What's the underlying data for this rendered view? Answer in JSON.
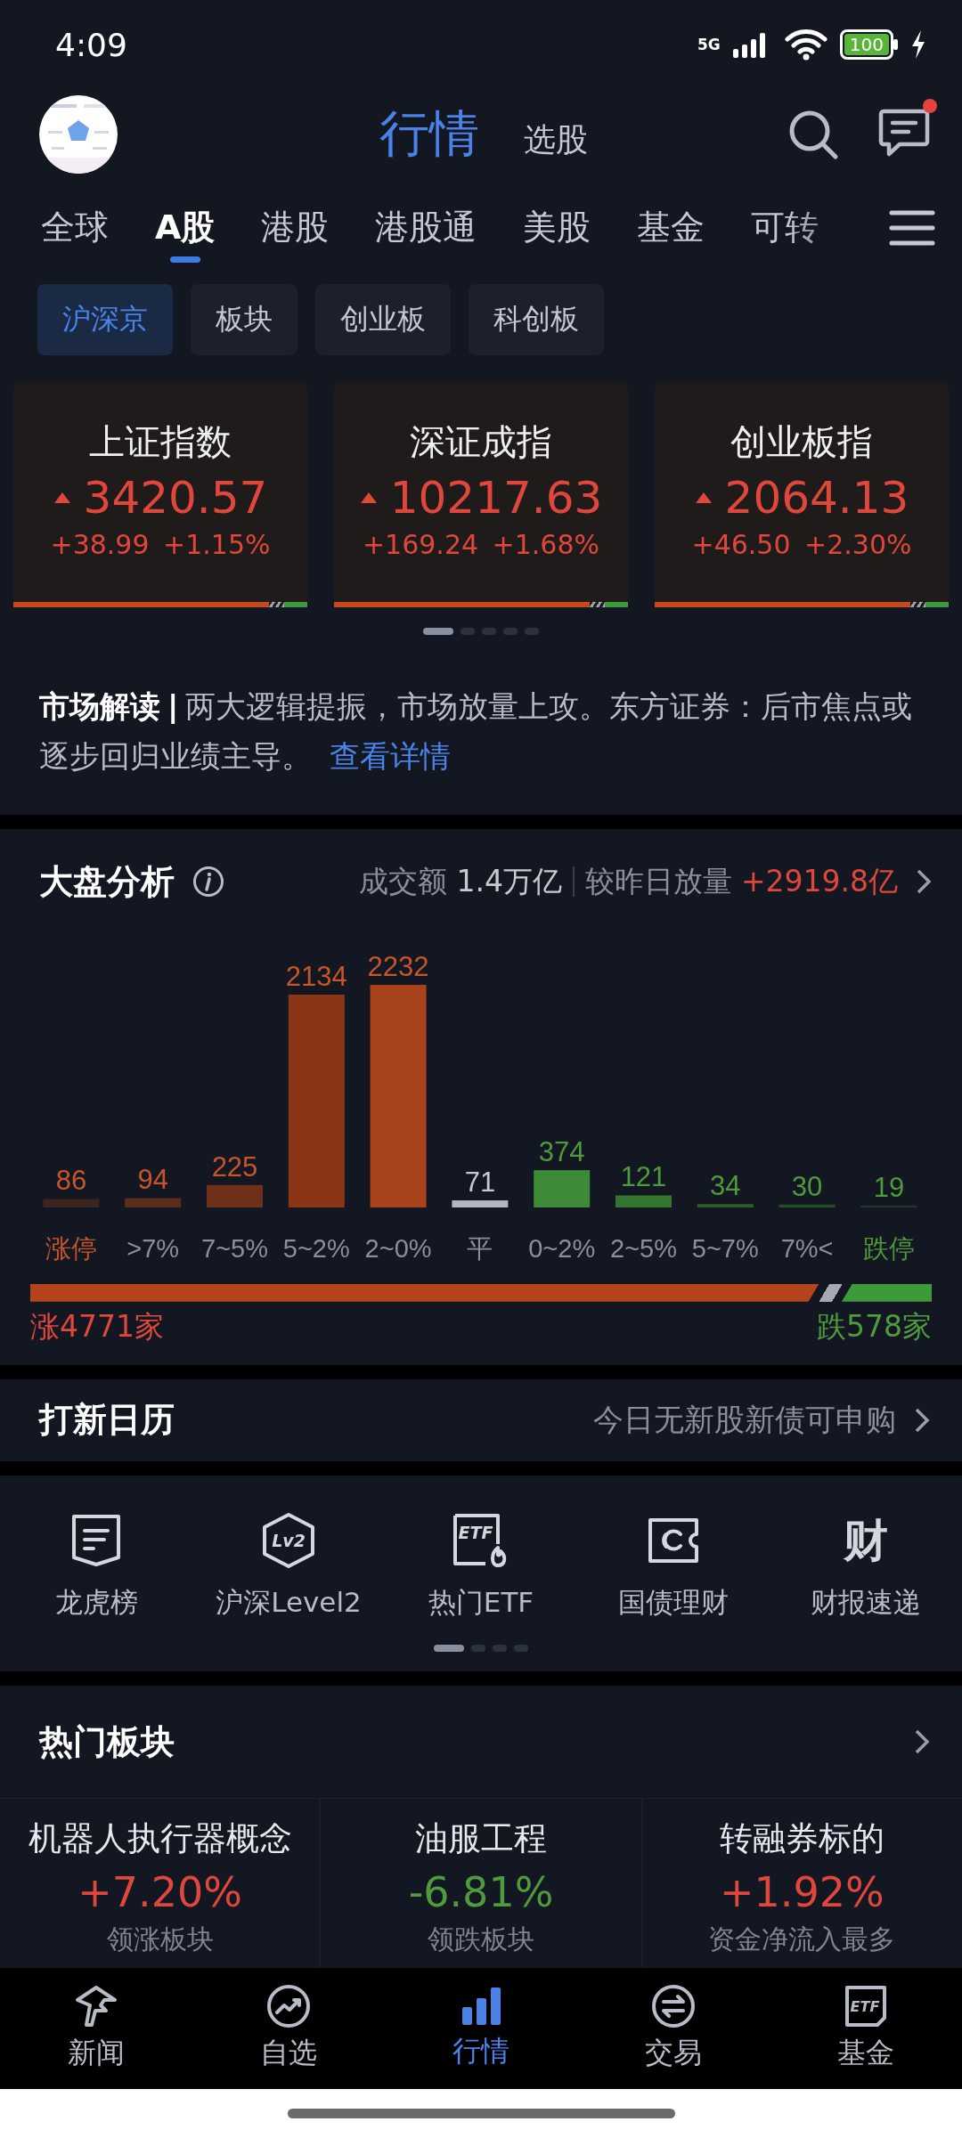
{
  "status_bar": {
    "time": "4:09",
    "network": "5G",
    "battery": "100"
  },
  "header": {
    "tabs": [
      {
        "label": "行情",
        "selected": true
      },
      {
        "label": "选股",
        "selected": false
      }
    ],
    "notification_dot": true
  },
  "market_tabs": [
    {
      "label": "全球",
      "selected": false
    },
    {
      "label": "A股",
      "selected": true
    },
    {
      "label": "港股",
      "selected": false
    },
    {
      "label": "港股通",
      "selected": false
    },
    {
      "label": "美股",
      "selected": false
    },
    {
      "label": "基金",
      "selected": false
    },
    {
      "label": "可转",
      "selected": false
    }
  ],
  "sub_tabs": [
    {
      "label": "沪深京",
      "selected": true
    },
    {
      "label": "板块",
      "selected": false
    },
    {
      "label": "创业板",
      "selected": false
    },
    {
      "label": "科创板",
      "selected": false
    }
  ],
  "indices": [
    {
      "name": "上证指数",
      "price": "3420.57",
      "change": "+38.99",
      "percent": "+1.15%",
      "level": 0.87
    },
    {
      "name": "深证成指",
      "price": "10217.63",
      "change": "+169.24",
      "percent": "+1.68%",
      "level": 0.87
    },
    {
      "name": "创业板指",
      "price": "2064.13",
      "change": "+46.50",
      "percent": "+2.30%",
      "level": 0.87
    }
  ],
  "index_pages": [
    {
      "selected": true
    },
    {
      "selected": false
    },
    {
      "selected": false
    },
    {
      "selected": false
    },
    {
      "selected": false
    }
  ],
  "brief": {
    "label": "市场解读",
    "separator": "|",
    "text": "两大逻辑提振，市场放量上攻。东方证券：后市焦点或逐步回归业绩主导。",
    "link": "查看详情"
  },
  "analysis": {
    "title": "大盘分析",
    "turnover_label": "成交额",
    "turnover": "1.4万亿",
    "compare_label": "较昨日放量",
    "compare": "+2919.8亿",
    "chart_data": {
      "type": "bar",
      "categories": [
        "涨停",
        ">7%",
        "7~5%",
        "5~2%",
        "2~0%",
        "平",
        "0~2%",
        "2~5%",
        "5~7%",
        "7%<",
        "跌停"
      ],
      "values": [
        86,
        94,
        225,
        2134,
        2232,
        71,
        374,
        121,
        34,
        30,
        19
      ],
      "data_labels": true
    },
    "rise_count": "涨4771家",
    "fall_count": "跌578家",
    "ratio": {
      "level": 0.875
    }
  },
  "ipo": {
    "title": "打新日历",
    "note": "今日无新股新债可申购"
  },
  "tools": {
    "items": [
      {
        "label": "龙虎榜",
        "kind": "list"
      },
      {
        "label": "沪深Level2",
        "kind": "hexagon",
        "badge": "Lv2"
      },
      {
        "label": "热门ETF",
        "kind": "etf",
        "badge": "ETF"
      },
      {
        "label": "国债理财",
        "kind": "ticket"
      },
      {
        "label": "财报速递",
        "kind": "glyph",
        "glyph": "财"
      }
    ],
    "pages": [
      {
        "selected": true
      },
      {
        "selected": false
      },
      {
        "selected": false
      },
      {
        "selected": false
      }
    ]
  },
  "hot_sectors": {
    "title": "热门板块",
    "items": [
      {
        "name": "机器人执行器概念",
        "change": "+7.20%",
        "kind": "up",
        "caption": "领涨板块"
      },
      {
        "name": "油服工程",
        "change": "-6.81%",
        "kind": "down",
        "caption": "领跌板块"
      },
      {
        "name": "转融券标的",
        "change": "+1.92%",
        "kind": "up",
        "caption": "资金净流入最多"
      }
    ]
  },
  "bottom_nav": [
    {
      "label": "新闻",
      "kind": "news",
      "selected": false
    },
    {
      "label": "自选",
      "kind": "trend",
      "selected": false
    },
    {
      "label": "行情",
      "kind": "bars",
      "selected": true
    },
    {
      "label": "交易",
      "kind": "swap",
      "selected": false
    },
    {
      "label": "基金",
      "kind": "etf",
      "selected": false,
      "badge": "ETF"
    }
  ]
}
